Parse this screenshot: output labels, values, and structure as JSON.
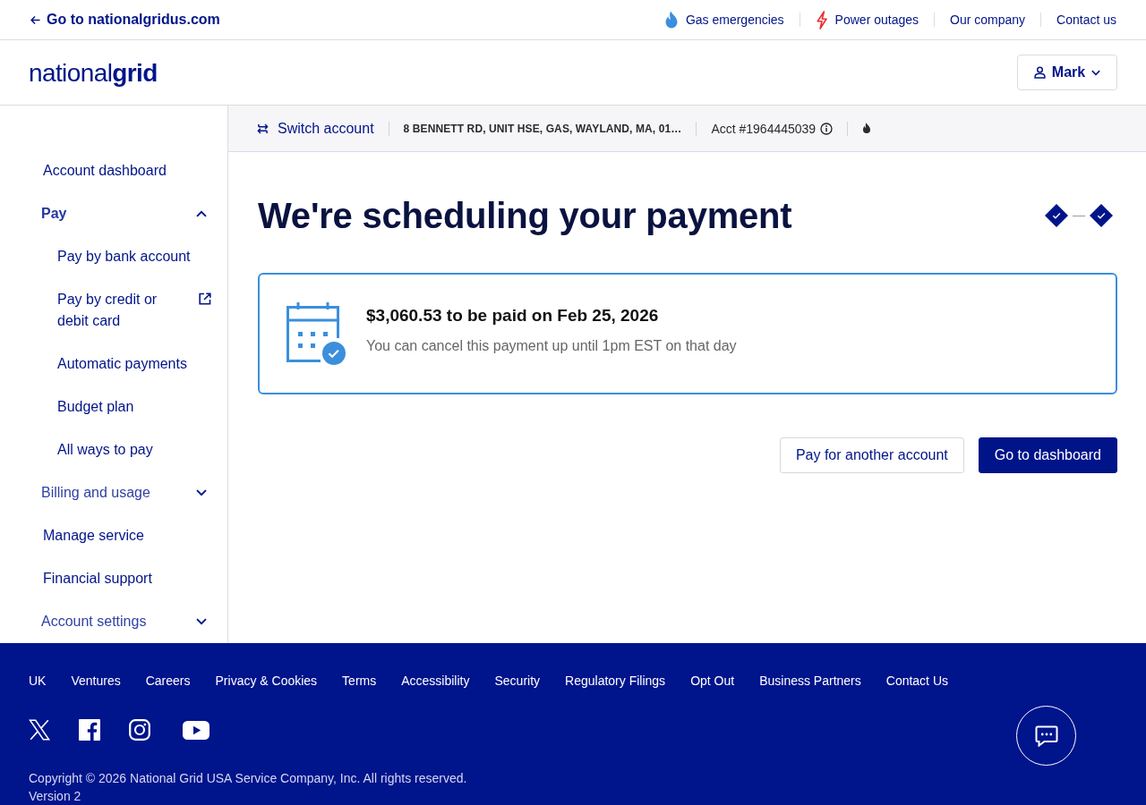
{
  "top_bar": {
    "back_link": "Go to nationalgridus.com",
    "links": [
      {
        "label": "Gas emergencies",
        "kind": "flame"
      },
      {
        "label": "Power outages",
        "kind": "bolt"
      },
      {
        "label": "Our company",
        "kind": "text"
      },
      {
        "label": "Contact us",
        "kind": "text"
      }
    ]
  },
  "header": {
    "logo": "national**grid**",
    "user_menu": {
      "label": "Mark",
      "expanded": false
    }
  },
  "sidebar": {
    "items": [
      {
        "label": "Account dashboard",
        "kind": "link",
        "selected": false
      },
      {
        "label": "Pay",
        "kind": "group",
        "selected": true,
        "expanded": true,
        "children": [
          {
            "label": "Pay by bank account",
            "selected": false,
            "external": false
          },
          {
            "label": "Pay by credit or debit card",
            "selected": false,
            "external": true
          },
          {
            "label": "Automatic payments",
            "selected": false,
            "external": false
          },
          {
            "label": "Budget plan",
            "selected": false,
            "external": false
          },
          {
            "label": "All ways to pay",
            "selected": false,
            "external": false
          }
        ]
      },
      {
        "label": "Billing and usage",
        "kind": "group",
        "selected": false,
        "expanded": false
      },
      {
        "label": "Manage service",
        "kind": "link",
        "selected": false
      },
      {
        "label": "Financial support",
        "kind": "link",
        "selected": false
      },
      {
        "label": "Account settings",
        "kind": "group",
        "selected": false,
        "expanded": false
      }
    ]
  },
  "account_bar": {
    "switch_label": "Switch account",
    "address": "8 BENNETT RD, UNIT HSE, GAS, WAYLAND, MA, 01…",
    "account_number": "Acct #1964445039"
  },
  "page": {
    "title": "We're scheduling your payment",
    "steps": [
      {
        "completed": true
      },
      {
        "completed": true
      }
    ],
    "payment_card": {
      "title": "$3,060.53 to be paid on Feb 25, 2026",
      "note": "You can cancel this payment up until 1pm EST on that day"
    },
    "buttons": [
      {
        "label": "Pay for another account",
        "kind": "secondary"
      },
      {
        "label": "Go to dashboard",
        "kind": "primary"
      }
    ]
  },
  "footer": {
    "links": [
      "UK",
      "Ventures",
      "Careers",
      "Privacy & Cookies",
      "Terms",
      "Accessibility",
      "Security",
      "Regulatory Filings",
      "Opt Out",
      "Business Partners",
      "Contact Us"
    ],
    "copyright": "Copyright © 2026 National Grid USA Service Company, Inc. All rights reserved.",
    "version": "Version 2"
  }
}
